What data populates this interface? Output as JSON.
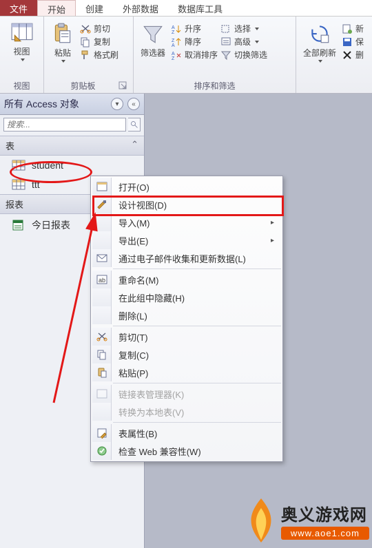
{
  "tabs": {
    "file": "文件",
    "home": "开始",
    "create": "创建",
    "external": "外部数据",
    "dbtools": "数据库工具"
  },
  "ribbon": {
    "view_group": "视图",
    "view_btn": "视图",
    "clipboard_group": "剪贴板",
    "paste_btn": "粘贴",
    "cut": "剪切",
    "copy": "复制",
    "format_painter": "格式刷",
    "filter_btn": "筛选器",
    "sortfilter_group": "排序和筛选",
    "asc": "升序",
    "desc": "降序",
    "clear_sort": "取消排序",
    "selection": "选择",
    "advanced": "高级",
    "toggle_filter": "切换筛选",
    "refresh_all": "全部刷新",
    "new_rec": "新",
    "save_rec": "保",
    "delete_rec": "删"
  },
  "nav": {
    "title": "所有 Access 对象",
    "search_placeholder": "搜索...",
    "tables": "表",
    "reports": "报表",
    "items": {
      "student": "student",
      "ttt": "ttt",
      "today_report": "今日报表"
    }
  },
  "context_menu": {
    "open": "打开(O)",
    "design_view": "设计视图(D)",
    "import": "导入(M)",
    "export": "导出(E)",
    "collect_email": "通过电子邮件收集和更新数据(L)",
    "rename": "重命名(M)",
    "hide_in_group": "在此组中隐藏(H)",
    "delete": "删除(L)",
    "cut": "剪切(T)",
    "copy": "复制(C)",
    "paste": "粘贴(P)",
    "linked_mgr": "链接表管理器(K)",
    "convert_local": "转换为本地表(V)",
    "table_props": "表属性(B)",
    "check_web": "检查 Web 兼容性(W)"
  },
  "watermark": {
    "name": "奥义游戏网",
    "url": "www.aoe1.com"
  }
}
